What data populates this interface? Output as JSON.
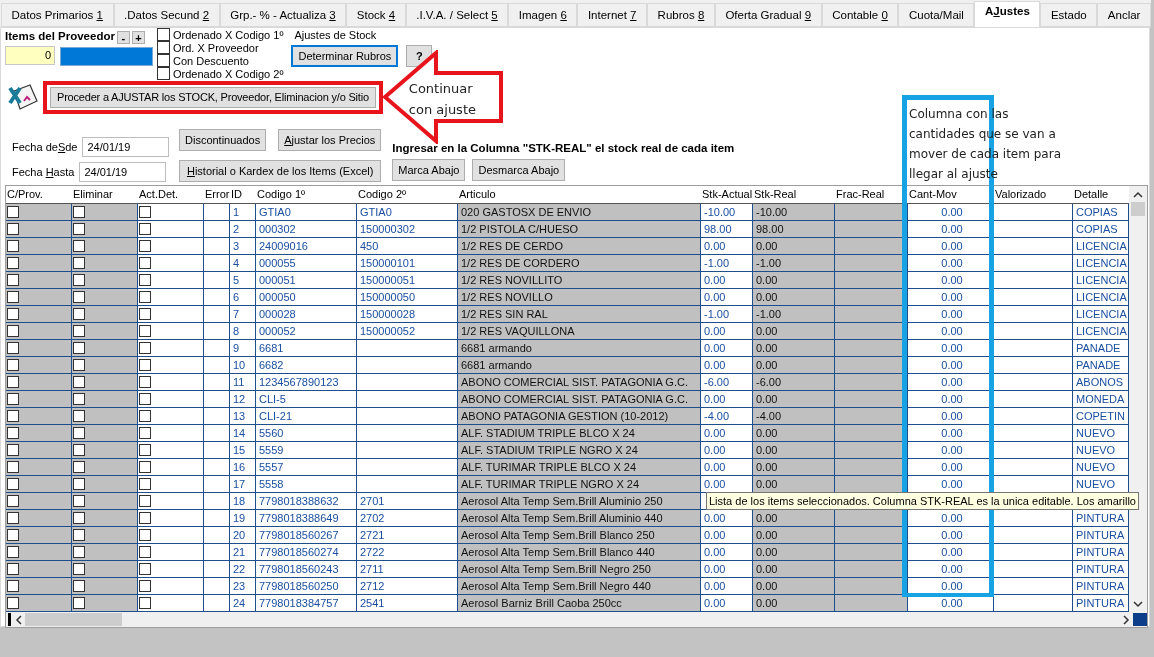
{
  "tabs": [
    {
      "label": "Datos Primarios ",
      "key": "1",
      "selected": false
    },
    {
      "label": ".Datos Secund ",
      "key": "2",
      "selected": false
    },
    {
      "label": "Grp.- % - Actualiza ",
      "key": "3",
      "selected": false
    },
    {
      "label": "Stock ",
      "key": "4",
      "selected": false
    },
    {
      "label": ".I.V.A. / Select ",
      "key": "5",
      "selected": false
    },
    {
      "label": "Imagen ",
      "key": "6",
      "selected": false
    },
    {
      "label": "Internet ",
      "key": "7",
      "selected": false
    },
    {
      "label": "Rubros ",
      "key": "8",
      "selected": false
    },
    {
      "label": "Oferta Gradual ",
      "key": "9",
      "selected": false
    },
    {
      "label": "Contable ",
      "key": "0",
      "selected": false
    },
    {
      "label": "Cuota/Mail",
      "selected": false
    },
    {
      "label": "A",
      "key": "J",
      "rest": "ustes",
      "selected": true
    },
    {
      "label": "Estado",
      "selected": false
    },
    {
      "label": "Anclar",
      "selected": false
    }
  ],
  "supplier_items": {
    "label": "Items del Proveedor",
    "minus": "-",
    "plus": "+",
    "count": "0"
  },
  "sort_options": [
    {
      "label": "Ordenado X Codigo 1º",
      "checked": false
    },
    {
      "label": "Ord. X Proveedor",
      "checked": false
    },
    {
      "label": "Con Descuento",
      "checked": false
    },
    {
      "label": "Ordenado X Codigo 2º",
      "checked": false
    }
  ],
  "section_title": "Ajustes de Stock",
  "determine_button": "Determinar Rubros",
  "help_button": "?",
  "proceed_button": "Proceder a AJUSTAR los STOCK, Proveedor, Eliminacion y/o Sitio",
  "date_from": {
    "label": {
      "label": "Fecha de",
      "key": "S",
      "rest": "de"
    },
    "value": "24/01/19"
  },
  "date_to": {
    "label": {
      "label": "Fecha ",
      "key": "H",
      "rest": "asta"
    },
    "value": "24/01/19"
  },
  "discontinued_button": {
    "label": "Discontinuados"
  },
  "adjust_prices_button": {
    "key": "A",
    "rest": "justar los Precios"
  },
  "history_button": {
    "key": "H",
    "rest": "istorial o Kardex de los Items (Excel)"
  },
  "instruction": "Ingresar en la Columna \"STK-REAL\" el stock real de cada item",
  "mark_down_button": "Marca Abajo",
  "unmark_down_button": "Desmarca Abajo",
  "table": {
    "columns": [
      {
        "label": "C/Prov.",
        "kind": "check"
      },
      {
        "label": "Eliminar",
        "kind": "check"
      },
      {
        "label": "Act.Det.",
        "kind": "check-white"
      },
      {
        "label": "Error",
        "kind": "plain"
      },
      {
        "label": "ID",
        "kind": "plain"
      },
      {
        "label": "Codigo 1º",
        "kind": "plain"
      },
      {
        "label": "Codigo 2º",
        "kind": "plain"
      },
      {
        "label": "Articulo",
        "kind": "shaded"
      },
      {
        "label": "Stk-Actual",
        "kind": "plain"
      },
      {
        "label": "Stk-Real",
        "kind": "shaded"
      },
      {
        "label": "Frac-Real",
        "kind": "shaded"
      },
      {
        "label": "Cant-Mov",
        "kind": "centered"
      },
      {
        "label": "Valorizado",
        "kind": "plain"
      },
      {
        "label": "Detalle",
        "kind": "plain"
      }
    ],
    "rows": [
      {
        "cells": [
          {
            "checked": false
          },
          {
            "checked": false
          },
          {
            "checked": false
          },
          null,
          "1",
          "GTIA0",
          "GTIA0",
          "020 GASTOSX DE ENVIO",
          "-10.00",
          "-10.00",
          null,
          "0.00",
          null,
          "COPIAS"
        ]
      },
      {
        "cells": [
          {
            "checked": false
          },
          {
            "checked": false
          },
          {
            "checked": false
          },
          null,
          "2",
          "000302",
          "150000302",
          "1/2 PISTOLA C/HUESO",
          "98.00",
          "98.00",
          null,
          "0.00",
          null,
          "COPIAS"
        ]
      },
      {
        "cells": [
          {
            "checked": false
          },
          {
            "checked": false
          },
          {
            "checked": false
          },
          null,
          "3",
          "24009016",
          "450",
          "1/2 RES DE CERDO",
          "0.00",
          "0.00",
          null,
          "0.00",
          null,
          "LICENCIA"
        ]
      },
      {
        "cells": [
          {
            "checked": false
          },
          {
            "checked": false
          },
          {
            "checked": false
          },
          null,
          "4",
          "000055",
          "150000101",
          "1/2 RES DE CORDERO",
          "-1.00",
          "-1.00",
          null,
          "0.00",
          null,
          "LICENCIA"
        ]
      },
      {
        "cells": [
          {
            "checked": false
          },
          {
            "checked": false
          },
          {
            "checked": false
          },
          null,
          "5",
          "000051",
          "150000051",
          "1/2 RES NOVILLITO",
          "0.00",
          "0.00",
          null,
          "0.00",
          null,
          "LICENCIA"
        ]
      },
      {
        "cells": [
          {
            "checked": false
          },
          {
            "checked": false
          },
          {
            "checked": false
          },
          null,
          "6",
          "000050",
          "150000050",
          "1/2 RES NOVILLO",
          "0.00",
          "0.00",
          null,
          "0.00",
          null,
          "LICENCIA"
        ]
      },
      {
        "cells": [
          {
            "checked": false
          },
          {
            "checked": false
          },
          {
            "checked": false
          },
          null,
          "7",
          "000028",
          "150000028",
          "1/2 RES SIN RAL",
          "-1.00",
          "-1.00",
          null,
          "0.00",
          null,
          "LICENCIA"
        ]
      },
      {
        "cells": [
          {
            "checked": false
          },
          {
            "checked": false
          },
          {
            "checked": false
          },
          null,
          "8",
          "000052",
          "150000052",
          "1/2 RES VAQUILLONA",
          "0.00",
          "0.00",
          null,
          "0.00",
          null,
          "LICENCIA"
        ]
      },
      {
        "cells": [
          {
            "checked": false
          },
          {
            "checked": false
          },
          {
            "checked": false
          },
          null,
          "9",
          "6681",
          null,
          "6681 armando",
          "0.00",
          "0.00",
          null,
          "0.00",
          null,
          "PANADE"
        ]
      },
      {
        "cells": [
          {
            "checked": false
          },
          {
            "checked": false
          },
          {
            "checked": false
          },
          null,
          "10",
          "6682",
          null,
          "6681 armando",
          "0.00",
          "0.00",
          null,
          "0.00",
          null,
          "PANADE"
        ]
      },
      {
        "cells": [
          {
            "checked": false
          },
          {
            "checked": false
          },
          {
            "checked": false
          },
          null,
          "11",
          "1234567890123",
          null,
          "ABONO COMERCIAL SIST. PATAGONIA G.C.",
          "-6.00",
          "-6.00",
          null,
          "0.00",
          null,
          "ABONOS"
        ]
      },
      {
        "cells": [
          {
            "checked": false
          },
          {
            "checked": false
          },
          {
            "checked": false
          },
          null,
          "12",
          "CLI-5",
          null,
          "ABONO COMERCIAL SIST. PATAGONIA G.C.",
          "0.00",
          "0.00",
          null,
          "0.00",
          null,
          "MONEDA"
        ]
      },
      {
        "cells": [
          {
            "checked": false
          },
          {
            "checked": false
          },
          {
            "checked": false
          },
          null,
          "13",
          "CLI-21",
          null,
          "ABONO PATAGONIA GESTION (10-2012)",
          "-4.00",
          "-4.00",
          null,
          "0.00",
          null,
          "COPETIN"
        ]
      },
      {
        "cells": [
          {
            "checked": false
          },
          {
            "checked": false
          },
          {
            "checked": false
          },
          null,
          "14",
          "5560",
          null,
          "ALF. STADIUM TRIPLE BLCO X 24",
          "0.00",
          "0.00",
          null,
          "0.00",
          null,
          "NUEVO"
        ]
      },
      {
        "cells": [
          {
            "checked": false
          },
          {
            "checked": false
          },
          {
            "checked": false
          },
          null,
          "15",
          "5559",
          null,
          "ALF. STADIUM TRIPLE NGRO X 24",
          "0.00",
          "0.00",
          null,
          "0.00",
          null,
          "NUEVO"
        ]
      },
      {
        "cells": [
          {
            "checked": false
          },
          {
            "checked": false
          },
          {
            "checked": false
          },
          null,
          "16",
          "5557",
          null,
          "ALF. TURIMAR TRIPLE BLCO X 24",
          "0.00",
          "0.00",
          null,
          "0.00",
          null,
          "NUEVO"
        ]
      },
      {
        "cells": [
          {
            "checked": false
          },
          {
            "checked": false
          },
          {
            "checked": false
          },
          null,
          "17",
          "5558",
          null,
          "ALF. TURIMAR TRIPLE NGRO X 24",
          "0.00",
          "0.00",
          null,
          "0.00",
          null,
          "NUEVO"
        ]
      },
      {
        "cells": [
          {
            "checked": false
          },
          {
            "checked": false
          },
          {
            "checked": false
          },
          null,
          "18",
          "7798018388632",
          "2701",
          "Aerosol Alta Temp Sem.Brill Aluminio 250"
        ]
      },
      {
        "cells": [
          {
            "checked": false
          },
          {
            "checked": false
          },
          {
            "checked": false
          },
          null,
          "19",
          "7798018388649",
          "2702",
          "Aerosol Alta Temp Sem.Brill Aluminio 440",
          "0.00",
          "0.00",
          null,
          "0.00",
          null,
          "PINTURA"
        ]
      },
      {
        "cells": [
          {
            "checked": false
          },
          {
            "checked": false
          },
          {
            "checked": false
          },
          null,
          "20",
          "7798018560267",
          "2721",
          "Aerosol Alta Temp Sem.Brill Blanco 250",
          "0.00",
          "0.00",
          null,
          "0.00",
          null,
          "PINTURA"
        ]
      },
      {
        "cells": [
          {
            "checked": false
          },
          {
            "checked": false
          },
          {
            "checked": false
          },
          null,
          "21",
          "7798018560274",
          "2722",
          "Aerosol Alta Temp Sem.Brill Blanco 440",
          "0.00",
          "0.00",
          null,
          "0.00",
          null,
          "PINTURA"
        ]
      },
      {
        "cells": [
          {
            "checked": false
          },
          {
            "checked": false
          },
          {
            "checked": false
          },
          null,
          "22",
          "7798018560243",
          "2711",
          "Aerosol Alta Temp Sem.Brill Negro 250",
          "0.00",
          "0.00",
          null,
          "0.00",
          null,
          "PINTURA"
        ]
      },
      {
        "cells": [
          {
            "checked": false
          },
          {
            "checked": false
          },
          {
            "checked": false
          },
          null,
          "23",
          "7798018560250",
          "2712",
          "Aerosol Alta Temp Sem.Brill Negro 440",
          "0.00",
          "0.00",
          null,
          "0.00",
          null,
          "PINTURA"
        ]
      },
      {
        "cells": [
          {
            "checked": false
          },
          {
            "checked": false
          },
          {
            "checked": false
          },
          null,
          "24",
          "7798018384757",
          "2541",
          "Aerosol Barniz Brill Caoba 250cc",
          "0.00",
          "0.00",
          null,
          "0.00",
          null,
          "PINTURA"
        ]
      }
    ]
  },
  "tooltip": "Lista de los items seleccionados. Columna STK-REAL es la unica editable. Los amarillo",
  "annotations": {
    "arrow_note": "Continuar con ajuste",
    "column_note": "Columna con las cantidades que se van a mover de cada item para llegar al ajuste"
  }
}
